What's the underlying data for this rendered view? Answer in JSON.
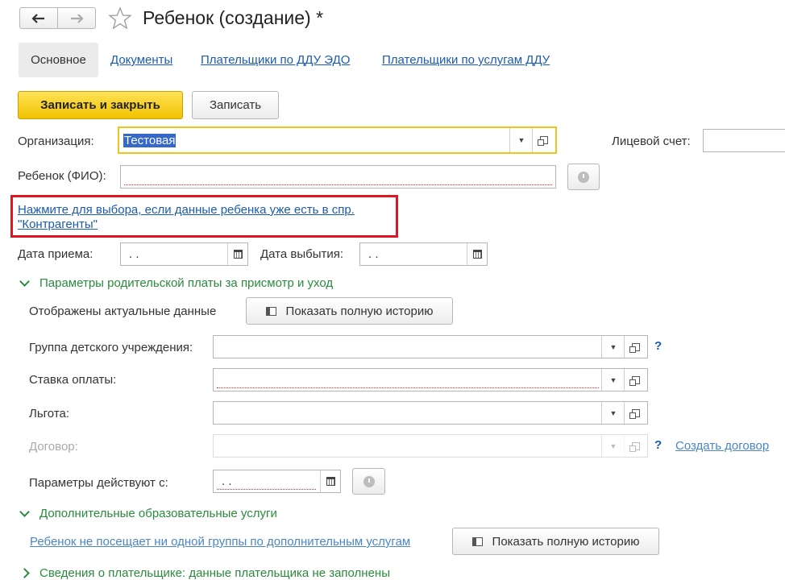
{
  "window": {
    "title": "Ребенок (создание) *"
  },
  "tabs": [
    {
      "label": "Основное"
    },
    {
      "label": "Документы"
    },
    {
      "label": "Плательщики по ДДУ ЭДО"
    },
    {
      "label": "Плательщики по услугам ДДУ"
    }
  ],
  "toolbar": {
    "save_close_label": "Записать и закрыть",
    "save_label": "Записать"
  },
  "org": {
    "label": "Организация:",
    "value": "Тестовая"
  },
  "account": {
    "label": "Лицевой счет:"
  },
  "child": {
    "label": "Ребенок (ФИО):",
    "value": ""
  },
  "select_link": {
    "line1": "Нажмите для выбора, если данные ребенка уже есть в спр.",
    "line2": "\"Контрагенты\""
  },
  "dates": {
    "admission_label": "Дата приема:",
    "admission_value": ". .",
    "leave_label": "Дата выбытия:",
    "leave_value": ". ."
  },
  "params_section": {
    "title": "Параметры родительской платы за присмотр и уход",
    "actual_label": "Отображены актуальные данные",
    "history_button": "Показать полную историю",
    "group_label": "Группа детского учреждения:",
    "group_help": "?",
    "rate_label": "Ставка оплаты:",
    "benefit_label": "Льгота:",
    "contract_label": "Договор:",
    "contract_help": "?",
    "create_contract_link": "Создать договор",
    "effective_label": "Параметры действуют с:",
    "effective_value": ". ."
  },
  "extra_section": {
    "title": "Дополнительные образовательные услуги",
    "not_attending_link": "Ребенок не посещает ни одной группы по дополнительным услугам",
    "history_button": "Показать полную историю"
  },
  "payer_section": {
    "title": "Сведения о плательщике: данные плательщика не заполнены"
  },
  "colors": {
    "accent": "#f5c400",
    "link": "#1a5bb4",
    "section": "#2b8a3e",
    "highlight_box": "#e0151f"
  }
}
